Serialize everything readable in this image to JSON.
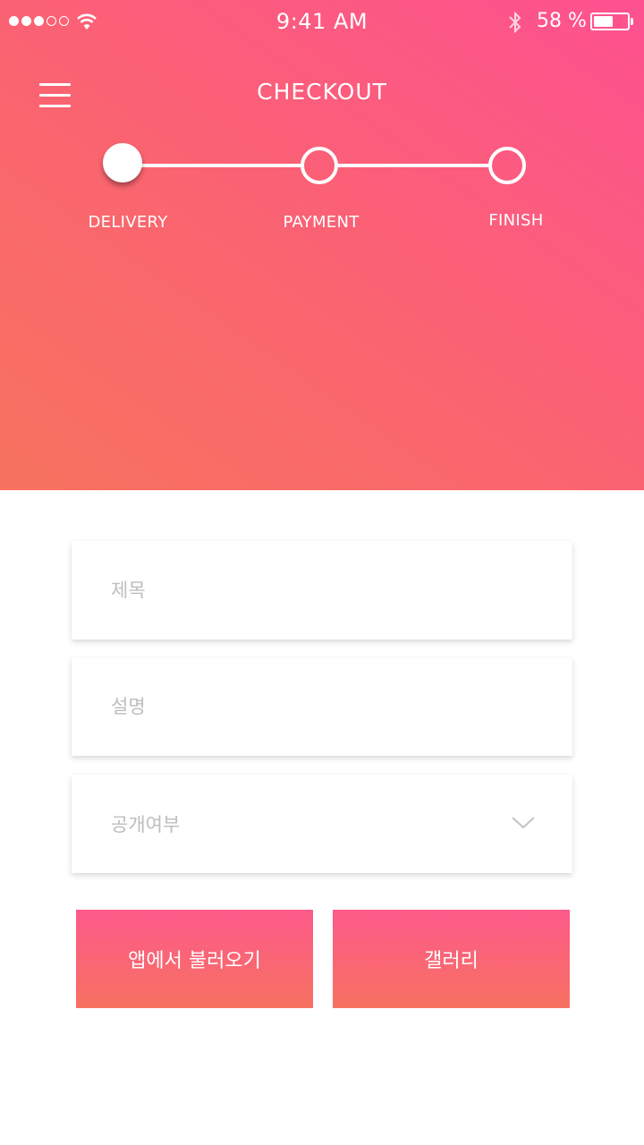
{
  "status_bar": {
    "time": "9:41 AM",
    "battery_percent": "58 %",
    "battery_level": 0.58,
    "signal_bars_filled": 3,
    "signal_bars_total": 5
  },
  "header": {
    "title": "CHECKOUT",
    "menu_icon": "hamburger-menu-icon"
  },
  "stepper": {
    "steps": [
      {
        "label": "DELIVERY",
        "active": true
      },
      {
        "label": "PAYMENT",
        "active": false
      },
      {
        "label": "FINISH",
        "active": false
      }
    ]
  },
  "form": {
    "title_field": {
      "placeholder": "제목",
      "value": ""
    },
    "description_field": {
      "placeholder": "설명",
      "value": ""
    },
    "visibility_select": {
      "placeholder": "공개여부"
    }
  },
  "buttons": {
    "import_from_app": "앱에서 불러오기",
    "gallery": "갤러리"
  },
  "colors": {
    "gradient_start": "#f7735f",
    "gradient_end": "#fe5190",
    "button_top": "#fd5a8a",
    "button_bottom": "#f77161"
  }
}
